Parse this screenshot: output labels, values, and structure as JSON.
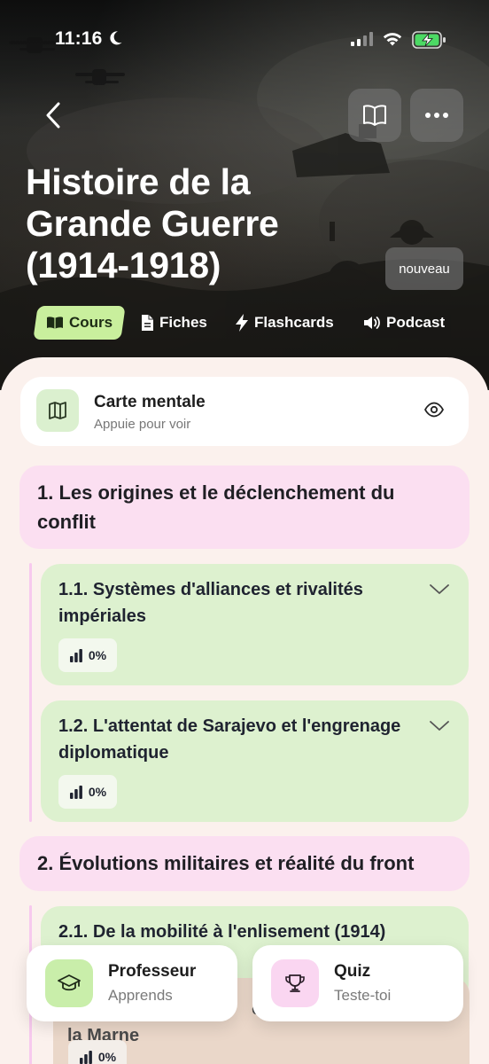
{
  "status_bar": {
    "time": "11:16"
  },
  "header": {
    "title": "Histoire de la Grande Guerre (1914-1918)",
    "badge": "nouveau"
  },
  "tabs": [
    {
      "label": "Cours",
      "active": true,
      "icon": "book-open-icon"
    },
    {
      "label": "Fiches",
      "active": false,
      "icon": "document-icon"
    },
    {
      "label": "Flashcards",
      "active": false,
      "icon": "lightning-icon"
    },
    {
      "label": "Podcast",
      "active": false,
      "icon": "speaker-icon"
    }
  ],
  "mind_map": {
    "title": "Carte mentale",
    "subtitle": "Appuie pour voir"
  },
  "sections": [
    {
      "title": "1. Les origines et le déclenchement du conflit",
      "subsections": [
        {
          "title": "1.1. Systèmes d'alliances et rivalités impériales",
          "progress": "0%"
        },
        {
          "title": "1.2. L'attentat de Sarajevo et l'engrenage diplomatique",
          "progress": "0%"
        }
      ]
    },
    {
      "title": "2. Évolutions militaires et réalité du front",
      "subsections": [
        {
          "title": "2.1. De la mobilité à l'enlisement (1914)",
          "progress": ""
        },
        {
          "title_fragment_1": "chl",
          "title_fragment_2": "la Marne",
          "progress": "0%"
        }
      ]
    }
  ],
  "actions": {
    "professor": {
      "title": "Professeur",
      "subtitle": "Apprends"
    },
    "quiz": {
      "title": "Quiz",
      "subtitle": "Teste-toi"
    }
  },
  "colors": {
    "accent_green": "#c9ef9d",
    "section_pink": "#fbdff1",
    "subsection_green": "#ddf1cf",
    "sheet_bg": "#fbf1ed"
  }
}
